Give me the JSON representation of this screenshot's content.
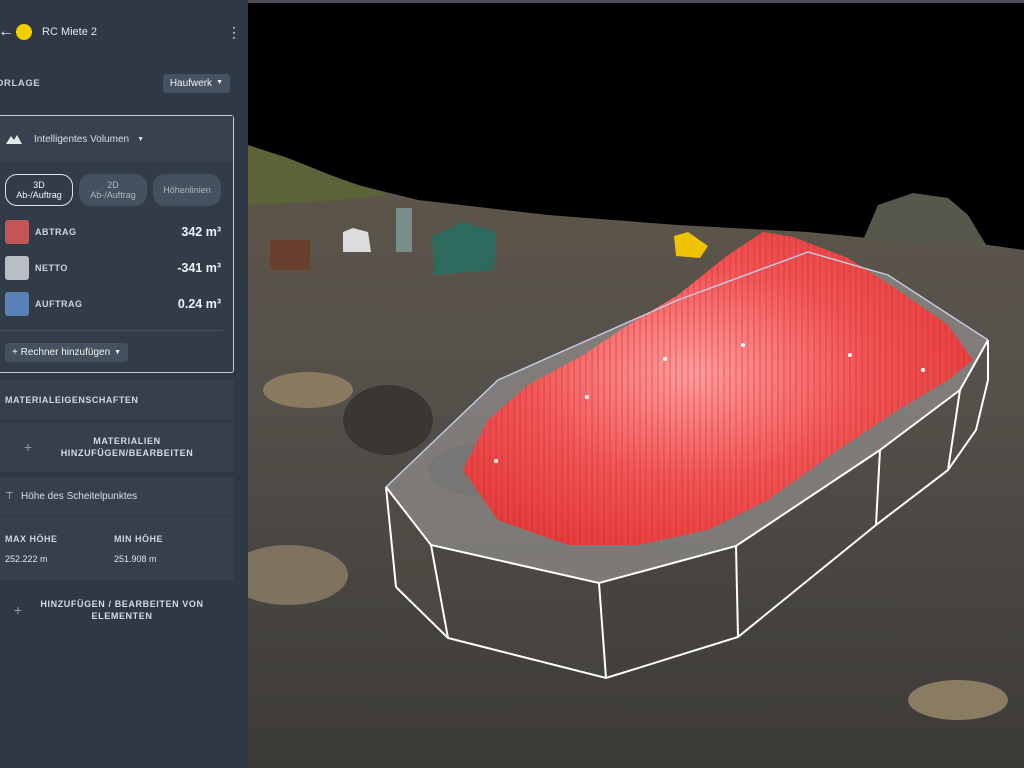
{
  "header": {
    "title": "RC Miete 2",
    "status_color": "#f4d000"
  },
  "vorlage": {
    "label": "ORLAGE",
    "value": "Haufwerk"
  },
  "volume_card": {
    "title": "Intelligentes Volumen",
    "tabs": [
      {
        "line1": "3D",
        "line2": "Ab-/Auftrag",
        "active": true
      },
      {
        "line1": "2D",
        "line2": "Ab-/Auftrag",
        "active": false
      },
      {
        "line1": "Höhenlinien",
        "line2": "",
        "active": false
      }
    ],
    "metrics": [
      {
        "label": "ABTRAG",
        "value": "342 m³",
        "color": "#c25656"
      },
      {
        "label": "NETTO",
        "value": "-341 m³",
        "color": "#b9bec4"
      },
      {
        "label": "AUFTRAG",
        "value": "0.24 m³",
        "color": "#5a80b8"
      }
    ],
    "add_calculator": "+ Rechner hinzufügen"
  },
  "material": {
    "header": "MATERIALEIGENSCHAFTEN",
    "add_label": "MATERIALIEN HINZUFÜGEN/BEARBEITEN"
  },
  "height": {
    "title": "Höhe des Scheitelpunktes",
    "max_label": "MAX HÖHE",
    "max_value": "252.222 m",
    "min_label": "MIN HÖHE",
    "min_value": "251.908 m"
  },
  "elements": {
    "add_label": "HINZUFÜGEN / BEARBEITEN VON ELEMENTEN"
  }
}
